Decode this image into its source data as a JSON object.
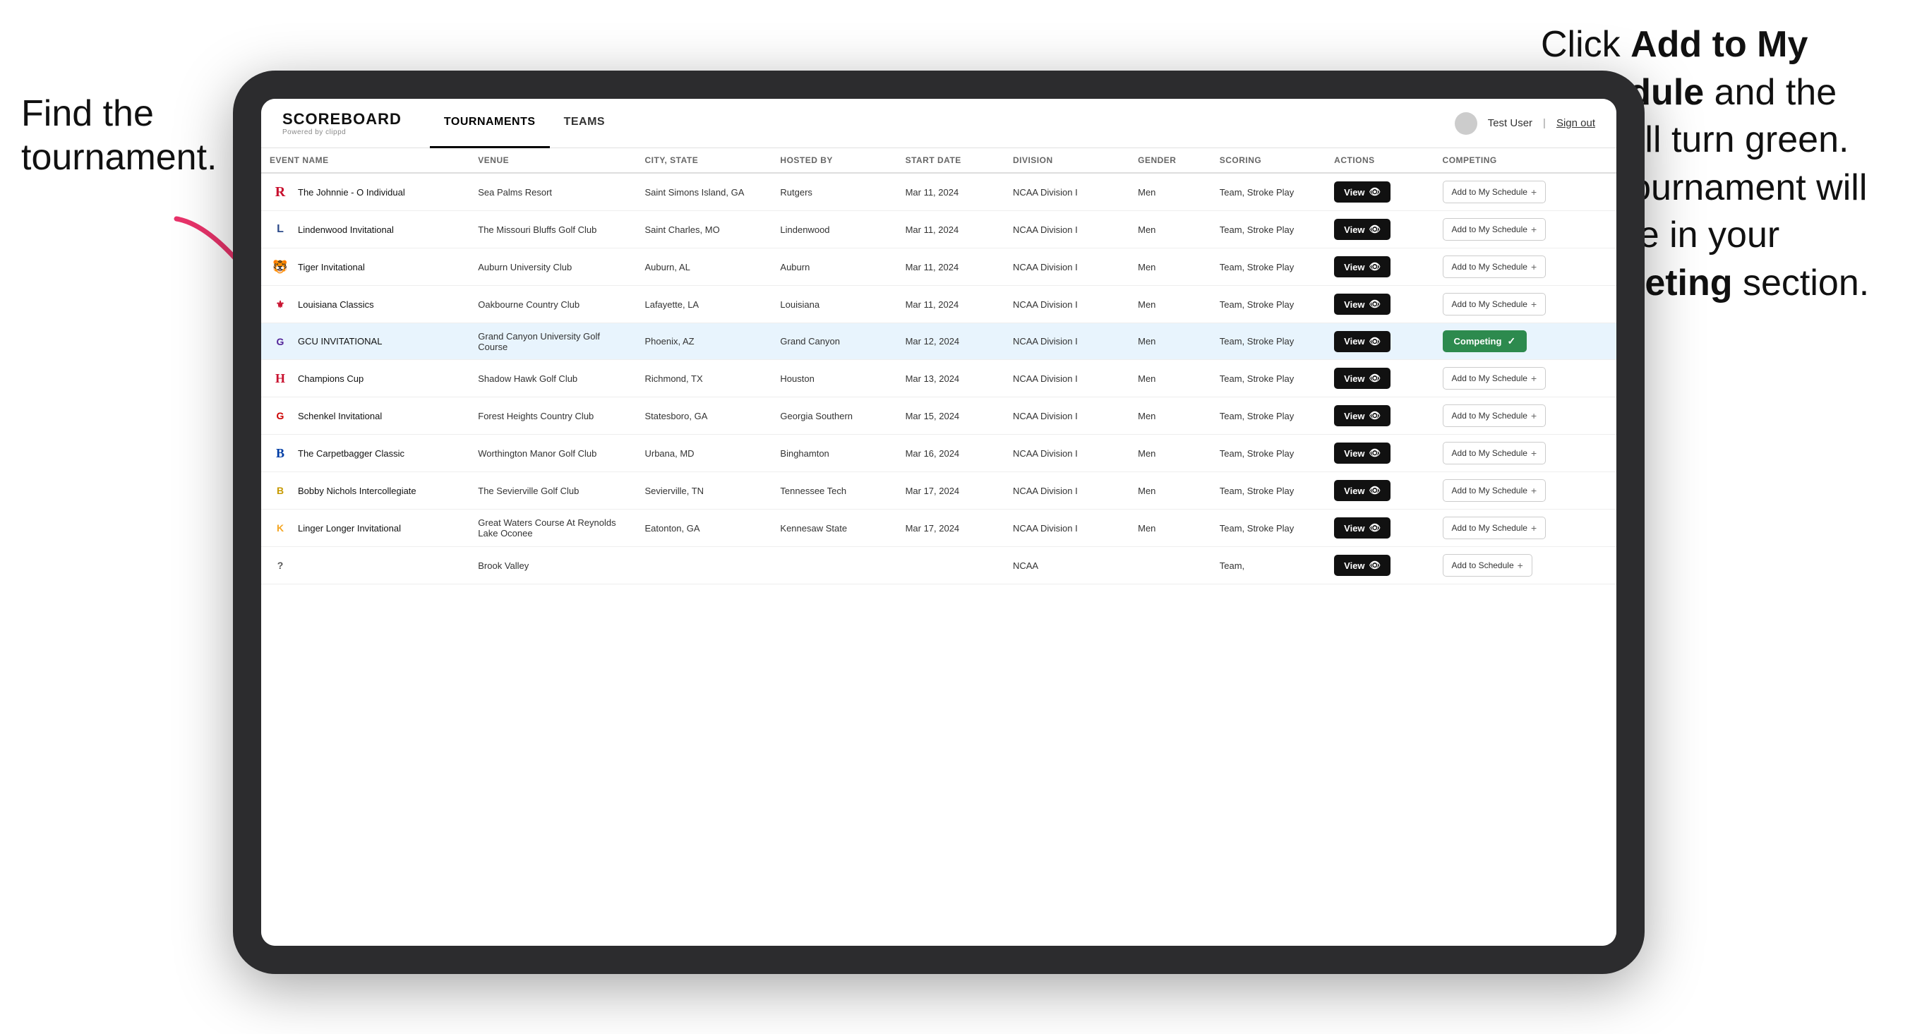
{
  "annotation_left": "Find the\ntournament.",
  "annotation_right_1": "Click ",
  "annotation_right_bold1": "Add to My Schedule",
  "annotation_right_2": " and the box will turn green. This tournament will now be in your ",
  "annotation_right_bold2": "Competing",
  "annotation_right_3": " section.",
  "navbar": {
    "logo": "SCOREBOARD",
    "logo_sub": "Powered by clippd",
    "tabs": [
      "TOURNAMENTS",
      "TEAMS"
    ],
    "active_tab": "TOURNAMENTS",
    "user": "Test User",
    "sign_out": "Sign out"
  },
  "table": {
    "columns": [
      "EVENT NAME",
      "VENUE",
      "CITY, STATE",
      "HOSTED BY",
      "START DATE",
      "DIVISION",
      "GENDER",
      "SCORING",
      "ACTIONS",
      "COMPETING"
    ],
    "rows": [
      {
        "logo": "R",
        "logo_class": "logo-r",
        "name": "The Johnnie - O Individual",
        "venue": "Sea Palms Resort",
        "city": "Saint Simons Island, GA",
        "hosted": "Rutgers",
        "date": "Mar 11, 2024",
        "division": "NCAA Division I",
        "gender": "Men",
        "scoring": "Team, Stroke Play",
        "action": "View",
        "competing": "Add to My Schedule",
        "status": "add",
        "highlighted": false
      },
      {
        "logo": "L",
        "logo_class": "logo-l",
        "name": "Lindenwood Invitational",
        "venue": "The Missouri Bluffs Golf Club",
        "city": "Saint Charles, MO",
        "hosted": "Lindenwood",
        "date": "Mar 11, 2024",
        "division": "NCAA Division I",
        "gender": "Men",
        "scoring": "Team, Stroke Play",
        "action": "View",
        "competing": "Add to My Schedule",
        "status": "add",
        "highlighted": false
      },
      {
        "logo": "🐯",
        "logo_class": "logo-tiger",
        "name": "Tiger Invitational",
        "venue": "Auburn University Club",
        "city": "Auburn, AL",
        "hosted": "Auburn",
        "date": "Mar 11, 2024",
        "division": "NCAA Division I",
        "gender": "Men",
        "scoring": "Team, Stroke Play",
        "action": "View",
        "competing": "Add to My Schedule",
        "status": "add",
        "highlighted": false
      },
      {
        "logo": "⚜",
        "logo_class": "logo-la",
        "name": "Louisiana Classics",
        "venue": "Oakbourne Country Club",
        "city": "Lafayette, LA",
        "hosted": "Louisiana",
        "date": "Mar 11, 2024",
        "division": "NCAA Division I",
        "gender": "Men",
        "scoring": "Team, Stroke Play",
        "action": "View",
        "competing": "Add to My Schedule",
        "status": "add",
        "highlighted": false
      },
      {
        "logo": "G",
        "logo_class": "logo-gcu",
        "name": "GCU INVITATIONAL",
        "venue": "Grand Canyon University Golf Course",
        "city": "Phoenix, AZ",
        "hosted": "Grand Canyon",
        "date": "Mar 12, 2024",
        "division": "NCAA Division I",
        "gender": "Men",
        "scoring": "Team, Stroke Play",
        "action": "View",
        "competing": "Competing",
        "status": "competing",
        "highlighted": true
      },
      {
        "logo": "H",
        "logo_class": "logo-h",
        "name": "Champions Cup",
        "venue": "Shadow Hawk Golf Club",
        "city": "Richmond, TX",
        "hosted": "Houston",
        "date": "Mar 13, 2024",
        "division": "NCAA Division I",
        "gender": "Men",
        "scoring": "Team, Stroke Play",
        "action": "View",
        "competing": "Add to My Schedule",
        "status": "add",
        "highlighted": false
      },
      {
        "logo": "G",
        "logo_class": "logo-g",
        "name": "Schenkel Invitational",
        "venue": "Forest Heights Country Club",
        "city": "Statesboro, GA",
        "hosted": "Georgia Southern",
        "date": "Mar 15, 2024",
        "division": "NCAA Division I",
        "gender": "Men",
        "scoring": "Team, Stroke Play",
        "action": "View",
        "competing": "Add to My Schedule",
        "status": "add",
        "highlighted": false
      },
      {
        "logo": "B",
        "logo_class": "logo-b",
        "name": "The Carpetbagger Classic",
        "venue": "Worthington Manor Golf Club",
        "city": "Urbana, MD",
        "hosted": "Binghamton",
        "date": "Mar 16, 2024",
        "division": "NCAA Division I",
        "gender": "Men",
        "scoring": "Team, Stroke Play",
        "action": "View",
        "competing": "Add to My Schedule",
        "status": "add",
        "highlighted": false
      },
      {
        "logo": "B",
        "logo_class": "logo-bn",
        "name": "Bobby Nichols Intercollegiate",
        "venue": "The Sevierville Golf Club",
        "city": "Sevierville, TN",
        "hosted": "Tennessee Tech",
        "date": "Mar 17, 2024",
        "division": "NCAA Division I",
        "gender": "Men",
        "scoring": "Team, Stroke Play",
        "action": "View",
        "competing": "Add to My Schedule",
        "status": "add",
        "highlighted": false
      },
      {
        "logo": "K",
        "logo_class": "logo-ksu",
        "name": "Linger Longer Invitational",
        "venue": "Great Waters Course At Reynolds Lake Oconee",
        "city": "Eatonton, GA",
        "hosted": "Kennesaw State",
        "date": "Mar 17, 2024",
        "division": "NCAA Division I",
        "gender": "Men",
        "scoring": "Team, Stroke Play",
        "action": "View",
        "competing": "Add to My Schedule",
        "status": "add",
        "highlighted": false
      },
      {
        "logo": "?",
        "logo_class": "logo-last",
        "name": "",
        "venue": "Brook Valley",
        "city": "",
        "hosted": "",
        "date": "",
        "division": "NCAA",
        "gender": "",
        "scoring": "Team,",
        "action": "View",
        "competing": "Add to Schedule",
        "status": "add",
        "highlighted": false
      }
    ]
  }
}
